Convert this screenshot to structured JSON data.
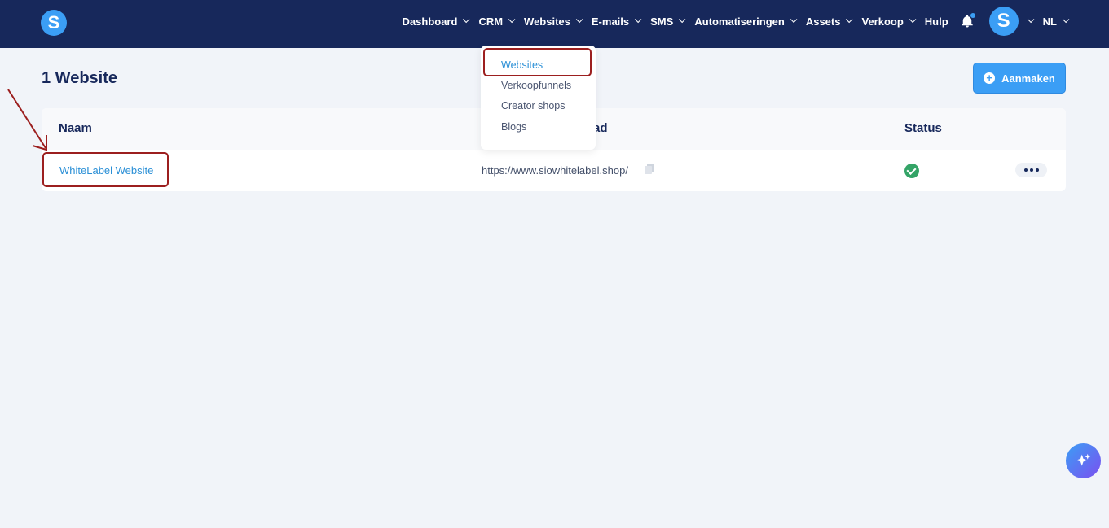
{
  "nav": {
    "items": [
      {
        "label": "Dashboard",
        "dropdown": true
      },
      {
        "label": "CRM",
        "dropdown": true
      },
      {
        "label": "Websites",
        "dropdown": true
      },
      {
        "label": "E-mails",
        "dropdown": true
      },
      {
        "label": "SMS",
        "dropdown": true
      },
      {
        "label": "Automatiseringen",
        "dropdown": true
      },
      {
        "label": "Assets",
        "dropdown": true
      },
      {
        "label": "Verkoop",
        "dropdown": true
      },
      {
        "label": "Hulp",
        "dropdown": false
      }
    ],
    "logo_letter": "S",
    "avatar_letter": "S",
    "language": "NL"
  },
  "dropdown": {
    "items": [
      "Websites",
      "Verkoopfunnels",
      "Creator shops",
      "Blogs"
    ],
    "active": "Websites"
  },
  "page": {
    "title": "1 Website",
    "create_label": "Aanmaken"
  },
  "table": {
    "headers": {
      "name": "Naam",
      "address": "ad",
      "status": "Status"
    },
    "rows": [
      {
        "name": "WhiteLabel Website",
        "address": "https://www.siowhitelabel.shop/",
        "status": "active"
      }
    ]
  },
  "colors": {
    "topbar": "#17285b",
    "accent": "#3b9ef5",
    "link": "#2a8fd6",
    "highlight": "#9c1f1f",
    "status_ok": "#34a467"
  }
}
